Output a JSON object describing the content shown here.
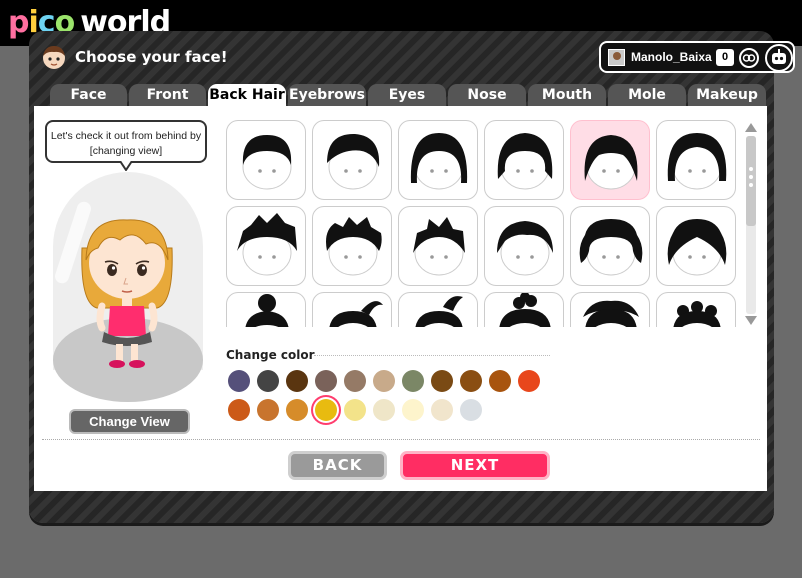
{
  "logo": {
    "pico": [
      "p",
      "i",
      "c",
      "o"
    ],
    "world": "world",
    "pico_colors": [
      "#ff6fa0",
      "#ffcf3d",
      "#6ed3f2",
      "#9be36b"
    ]
  },
  "header": {
    "title": "Choose your face!",
    "title_icon": "boy-face-icon"
  },
  "user": {
    "name": "Manolo_Baixa",
    "count": "0",
    "icons": [
      "profile-picture",
      "friends-icon",
      "robot-menu-icon"
    ]
  },
  "tabs": [
    {
      "label": "Face",
      "active": false
    },
    {
      "label": "Front Hair",
      "active": false
    },
    {
      "label": "Back Hair",
      "active": true
    },
    {
      "label": "Eyebrows",
      "active": false
    },
    {
      "label": "Eyes",
      "active": false
    },
    {
      "label": "Nose",
      "active": false
    },
    {
      "label": "Mouth",
      "active": false
    },
    {
      "label": "Mole",
      "active": false
    },
    {
      "label": "Makeup",
      "active": false
    }
  ],
  "preview": {
    "bubble_text": "Let's check it out from behind by [changing view]",
    "change_view_label": "Change View",
    "hair_color": "#e8a93a",
    "shirt_color": "#ff2d6e"
  },
  "hair_options": {
    "selected_index": 4,
    "styles": [
      "bob",
      "side-swept",
      "long-straight",
      "shag",
      "long-bangs",
      "helmet",
      "spiky",
      "messy",
      "tousled",
      "short-wave",
      "curly-bob",
      "wavy",
      "bun",
      "ponytail",
      "high-ponytail",
      "messy-bun",
      "curly-top",
      "tight-curls"
    ]
  },
  "change_color": {
    "label": "Change color",
    "selected_index": 14,
    "colors": [
      "#55507a",
      "#444444",
      "#5a3510",
      "#7a625a",
      "#957a66",
      "#c8aa8a",
      "#7b8766",
      "#7a4a14",
      "#8a4e12",
      "#a8540e",
      "#e8471c",
      "#cc5a18",
      "#c8742e",
      "#d68c2a",
      "#e8bb10",
      "#f3e38a",
      "#efe6c8",
      "#fdf4cc",
      "#f1e5cc",
      "#d9dee3"
    ]
  },
  "buttons": {
    "back": "BACK",
    "next": "NEXT"
  },
  "scrollbar": {
    "visible": true
  }
}
